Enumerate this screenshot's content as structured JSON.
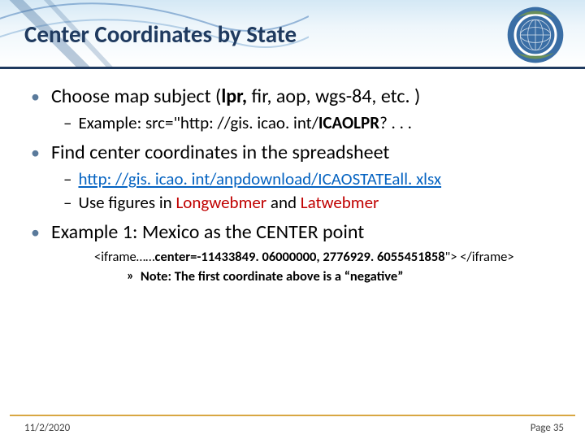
{
  "title": "Center Coordinates by State",
  "logo": {
    "alt": "ICAO Logo"
  },
  "bullets": {
    "b1a_pre": "Choose map subject (",
    "b1a_bold": "lpr, ",
    "b1a_post": "fir, aop, wgs-84, etc. )",
    "b1a_sub_pre": "Example: src=\"http: //gis. icao. int/",
    "b1a_sub_bold": "ICAOLPR",
    "b1a_sub_post": "? . . .",
    "b1b": "Find center coordinates in the spreadsheet",
    "b1b_link": "http: //gis. icao. int/anpdownload/ICAOSTATEall. xlsx",
    "b1b_use_pre": "Use figures in ",
    "b1b_use_long": "Longwebmer",
    "b1b_use_and": " and ",
    "b1b_use_lat": "Latwebmer",
    "b1c": "Example 1: Mexico as the CENTER point",
    "b1c_code_pre": "<iframe……",
    "b1c_code_bold": "center=-11433849. 06000000, 2776929. 6055451858",
    "b1c_code_post": "\"> </iframe>",
    "b1c_note": "Note: The first coordinate above is a “negative”"
  },
  "footer": {
    "date": "11/2/2020",
    "page": "Page 35"
  }
}
